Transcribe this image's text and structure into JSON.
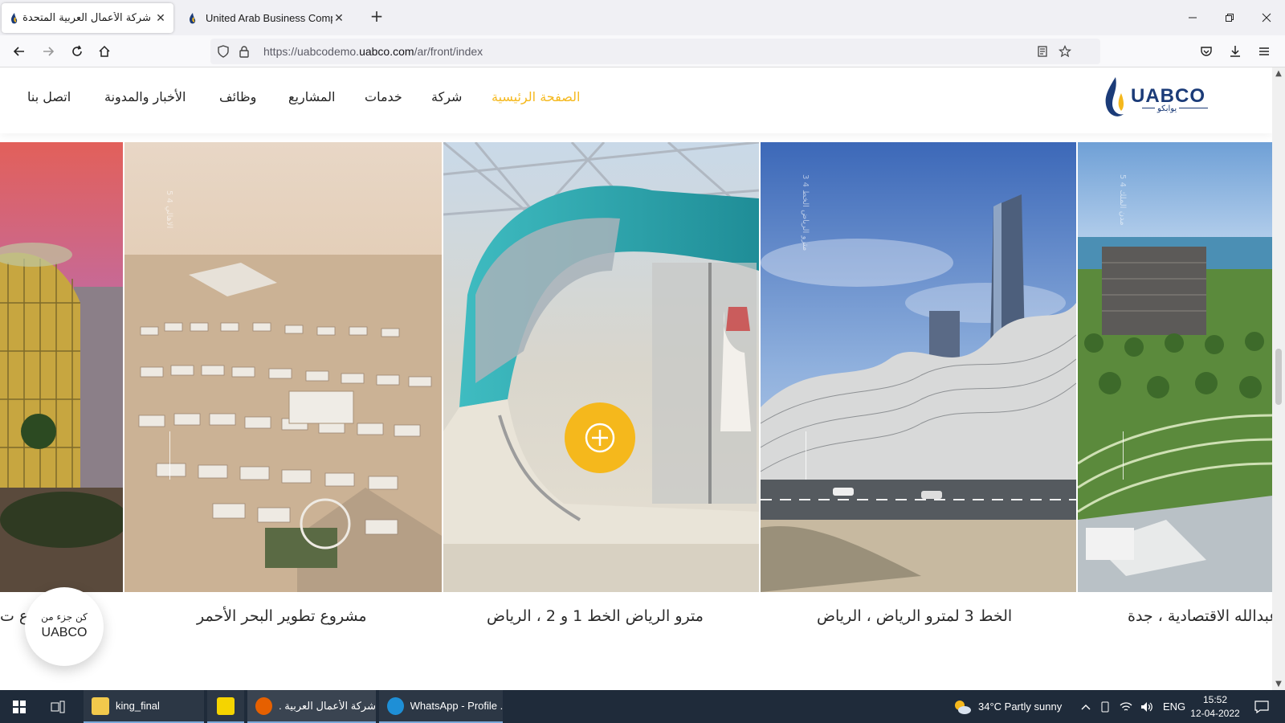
{
  "browser": {
    "tabs": [
      {
        "title": "شركة الأعمال العربية المتحدة",
        "close": "✕"
      },
      {
        "title": "United Arab Business Company",
        "close": "✕"
      }
    ],
    "new_tab": "+",
    "url_scheme": "https://uabcodemo.",
    "url_host": "uabco.com",
    "url_path": "/ar/front/index"
  },
  "site": {
    "logo_text": "UABCO",
    "logo_sub": "يوابكو",
    "menu": [
      {
        "label": "الصفحة الرئيسية",
        "active": true
      },
      {
        "label": "شركة"
      },
      {
        "label": "خدمات"
      },
      {
        "label": "المشاريع"
      },
      {
        "label": "وظائف"
      },
      {
        "label": "الأخبار والمدونة"
      },
      {
        "label": "اتصل بنا"
      }
    ],
    "slides": [
      {
        "caption": "ـوع ت",
        "vtext": ""
      },
      {
        "caption": "مشروع تطوير البحر الأحمر",
        "vtext": "5 4 الاهالي"
      },
      {
        "caption": "مترو الرياض الخط 1 و 2 ، الرياض",
        "vtext": ""
      },
      {
        "caption": "الخط 3 لمترو الرياض ، الرياض",
        "vtext": "مترو الرياض الخط 4 3"
      },
      {
        "caption": "عبدالله الاقتصادية ، جدة",
        "vtext": "مدن الملك 4 5"
      }
    ],
    "plus_symbol": "+",
    "join": {
      "line1": "كن جزء من",
      "line2": "UABCO"
    },
    "colors": {
      "accent": "#f5b81c",
      "logo_blue": "#1b3b78"
    }
  },
  "taskbar": {
    "apps": [
      {
        "label": "king_final",
        "icon": "folder-icon"
      },
      {
        "label": "",
        "icon": "player-icon"
      },
      {
        "label": "شركة الأعمال العربية ...",
        "icon": "firefox-icon"
      },
      {
        "label": "WhatsApp - Profile ...",
        "icon": "edge-icon"
      }
    ],
    "weather": "34°C  Partly sunny",
    "lang": "ENG",
    "time": "15:52",
    "date": "12-04-2022"
  }
}
